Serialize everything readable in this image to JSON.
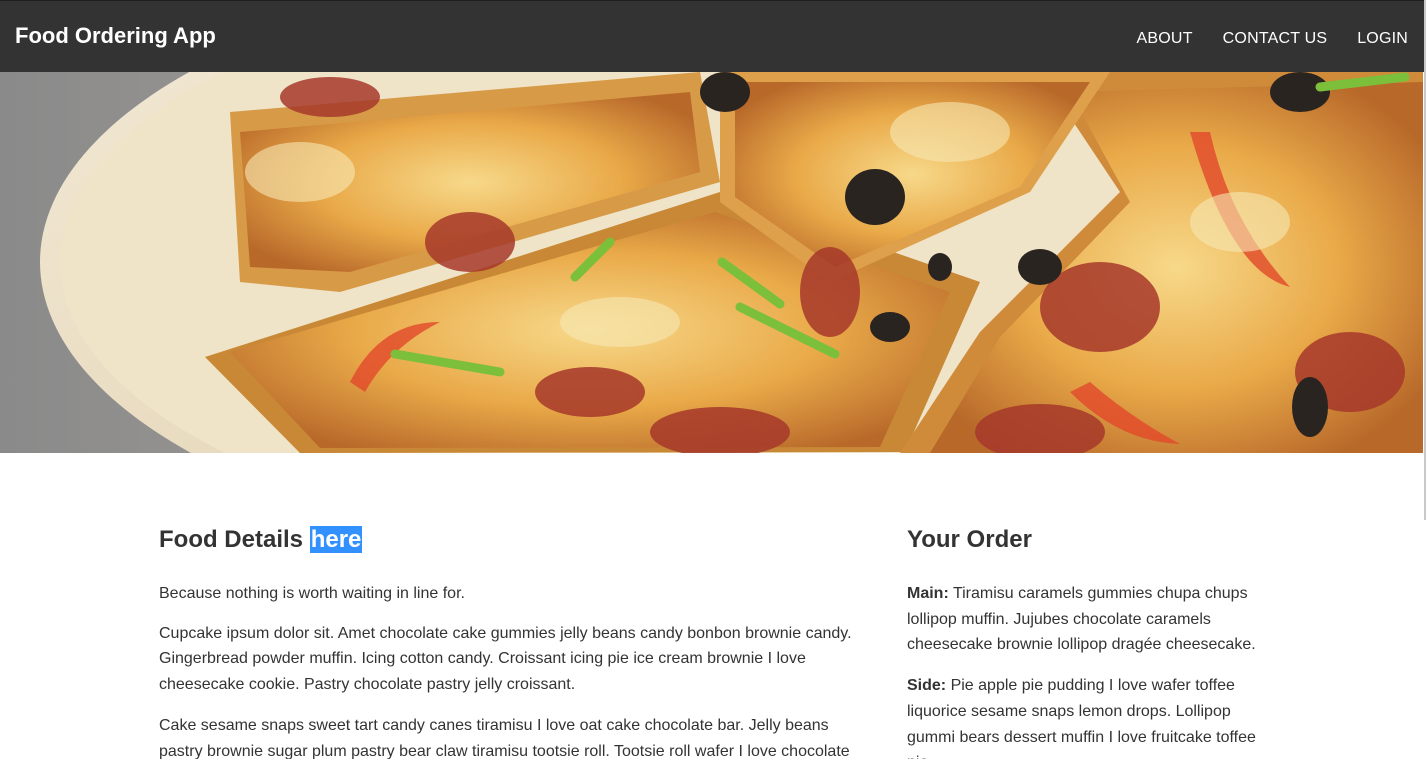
{
  "navbar": {
    "brand": "Food Ordering App",
    "links": [
      "ABOUT",
      "CONTACT US",
      "LOGIN"
    ]
  },
  "hero": {
    "image": "pizza-slices-photo"
  },
  "food_details": {
    "title": "Food Details",
    "title_highlight": "here",
    "tagline": "Because nothing is worth waiting in line for.",
    "paragraphs": [
      "Cupcake ipsum dolor sit. Amet chocolate cake gummies jelly beans candy bonbon brownie candy. Gingerbread powder muffin. Icing cotton candy. Croissant icing pie ice cream brownie I love cheesecake cookie. Pastry chocolate pastry jelly croissant.",
      "Cake sesame snaps sweet tart candy canes tiramisu I love oat cake chocolate bar. Jelly beans pastry brownie sugar plum pastry bear claw tiramisu tootsie roll. Tootsie roll wafer I love chocolate"
    ]
  },
  "order": {
    "title": "Your Order",
    "items": [
      {
        "label": "Main:",
        "text": "Tiramisu caramels gummies chupa chups lollipop muffin. Jujubes chocolate caramels cheesecake brownie lollipop dragée cheesecake."
      },
      {
        "label": "Side:",
        "text": "Pie apple pie pudding I love wafer toffee liquorice sesame snaps lemon drops. Lollipop gummi bears dessert muffin I love fruitcake toffee pie."
      }
    ]
  },
  "colors": {
    "navbar_bg": "#333333",
    "selection_highlight": "#3390ff",
    "text": "#333333"
  }
}
